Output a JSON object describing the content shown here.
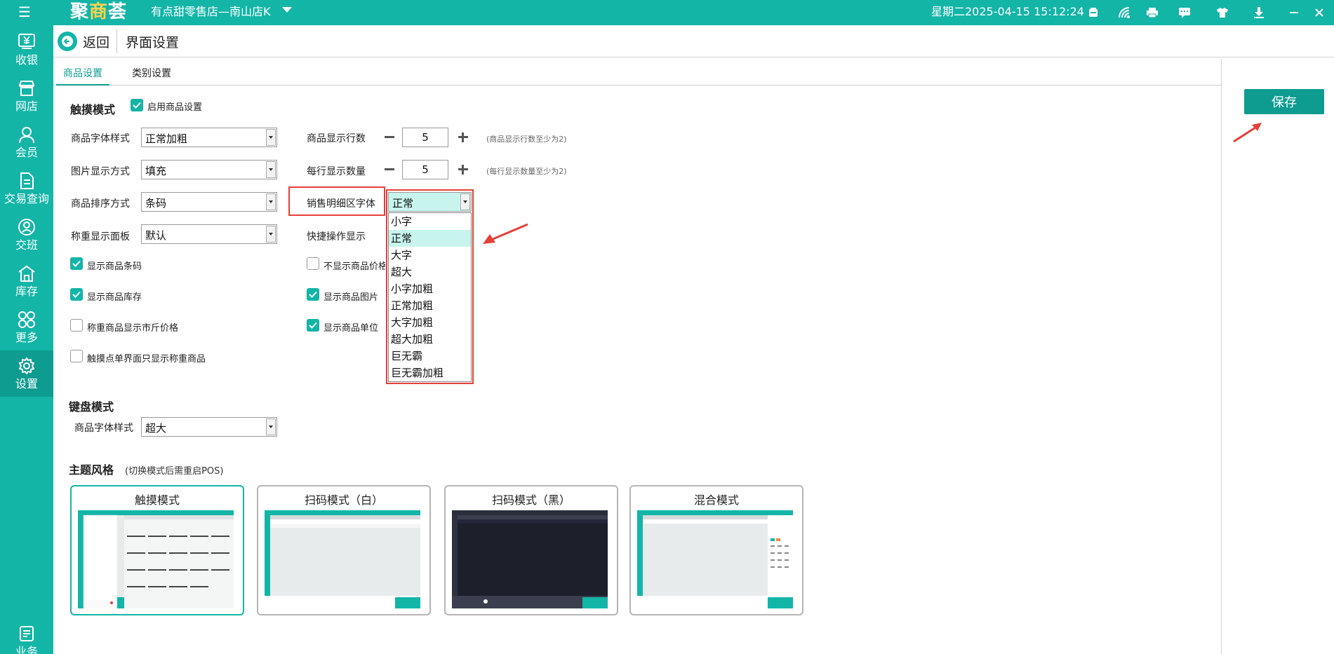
{
  "topbar": {
    "logo_part1": "聚",
    "logo_part2": "商",
    "logo_part3": "荟",
    "store_name": "有点甜零售店—南山店K",
    "datetime": "星期二2025-04-15 15:12:24"
  },
  "sidebar": {
    "items": [
      {
        "label": "收银",
        "icon": "cash-register-icon"
      },
      {
        "label": "网店",
        "icon": "store-icon"
      },
      {
        "label": "会员",
        "icon": "member-icon"
      },
      {
        "label": "交易查询",
        "icon": "document-icon"
      },
      {
        "label": "交班",
        "icon": "shift-icon"
      },
      {
        "label": "库存",
        "icon": "warehouse-icon"
      },
      {
        "label": "更多",
        "icon": "more-icon"
      },
      {
        "label": "设置",
        "icon": "gear-icon"
      },
      {
        "label": "业务",
        "icon": "business-icon"
      }
    ]
  },
  "header": {
    "back_label": "返回",
    "title": "界面设置"
  },
  "tabs": [
    {
      "label": "商品设置",
      "active": true
    },
    {
      "label": "类别设置",
      "active": false
    }
  ],
  "touch_mode": {
    "title": "触摸模式",
    "enable_label": "启用商品设置",
    "enable_checked": true,
    "font_style_label": "商品字体样式",
    "font_style_value": "正常加粗",
    "image_display_label": "图片显示方式",
    "image_display_value": "填充",
    "sort_label": "商品排序方式",
    "sort_value": "条码",
    "weigh_panel_label": "称重显示面板",
    "weigh_panel_value": "默认",
    "rows_label": "商品显示行数",
    "rows_value": "5",
    "rows_hint": "(商品显示行数至少为2)",
    "per_row_label": "每行显示数量",
    "per_row_value": "5",
    "per_row_hint": "(每行显示数量至少为2)",
    "sales_font_label": "销售明细区字体",
    "sales_font_value": "正常",
    "quick_op_label": "快捷操作显示",
    "checkboxes": {
      "show_barcode": {
        "label": "显示商品条码",
        "checked": true
      },
      "show_stock": {
        "label": "显示商品库存",
        "checked": true
      },
      "weigh_jin_price": {
        "label": "称重商品显示市斤价格",
        "checked": false
      },
      "only_weigh": {
        "label": "触摸点单界面只显示称重商品",
        "checked": false
      },
      "hide_price": {
        "label": "不显示商品价格",
        "checked": false
      },
      "show_image": {
        "label": "显示商品图片",
        "checked": true
      },
      "show_unit": {
        "label": "显示商品单位",
        "checked": true
      }
    }
  },
  "sales_font_options": [
    "小字",
    "正常",
    "大字",
    "超大",
    "小字加粗",
    "正常加粗",
    "大字加粗",
    "超大加粗",
    "巨无霸",
    "巨无霸加粗"
  ],
  "sales_font_selected": "正常",
  "keyboard_mode": {
    "title": "键盘模式",
    "font_style_label": "商品字体样式",
    "font_style_value": "超大"
  },
  "theme": {
    "title": "主题风格",
    "note": "(切换模式后需重启POS)",
    "cards": [
      {
        "label": "触摸模式",
        "active": true
      },
      {
        "label": "扫码模式（白）",
        "active": false
      },
      {
        "label": "扫码模式（黑）",
        "active": false
      },
      {
        "label": "混合模式",
        "active": false
      }
    ]
  },
  "save_label": "保存",
  "colors": {
    "brand": "#13b5a7",
    "brand_dark": "#0e9c90",
    "highlight": "#e5403a",
    "selected_option": "#c8f4ee"
  }
}
